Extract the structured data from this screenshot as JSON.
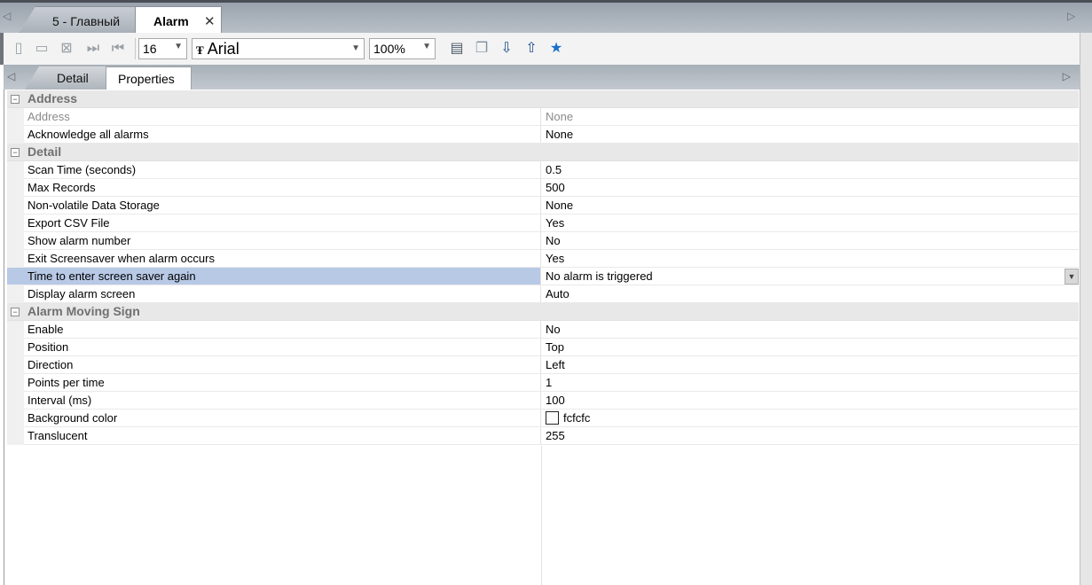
{
  "doc_tabs": [
    {
      "label": "5 - Главный",
      "active": false
    },
    {
      "label": "Alarm",
      "active": true
    }
  ],
  "toolbar": {
    "font_size": "16",
    "font_name": "Arial",
    "zoom": "100%",
    "icons": [
      "new-page-icon",
      "paste-icon",
      "delete-icon",
      "next-icon",
      "prev-icon",
      "export-icon",
      "layers-icon",
      "import-down-icon",
      "export-up-icon",
      "star-icon"
    ]
  },
  "sub_tabs": [
    {
      "label": "Detail",
      "active": false
    },
    {
      "label": "Properties",
      "active": true
    }
  ],
  "categories": {
    "address": "Address",
    "detail": "Detail",
    "moving_sign": "Alarm Moving Sign"
  },
  "props": {
    "address": [
      {
        "name": "Address",
        "value": "None",
        "disabled": true
      },
      {
        "name": "Acknowledge all alarms",
        "value": "None"
      }
    ],
    "detail": [
      {
        "name": "Scan Time (seconds)",
        "value": "0.5"
      },
      {
        "name": "Max Records",
        "value": "500"
      },
      {
        "name": "Non-volatile Data Storage",
        "value": "None"
      },
      {
        "name": "Export CSV File",
        "value": "Yes"
      },
      {
        "name": "Show alarm number",
        "value": "No"
      },
      {
        "name": "Exit Screensaver when alarm occurs",
        "value": "Yes"
      },
      {
        "name": "Time to enter screen saver again",
        "value": "No alarm is triggered",
        "selected": true
      },
      {
        "name": "Display alarm screen",
        "value": "Auto"
      }
    ],
    "moving_sign": [
      {
        "name": "Enable",
        "value": "No"
      },
      {
        "name": "Position",
        "value": "Top"
      },
      {
        "name": "Direction",
        "value": "Left"
      },
      {
        "name": "Points per time",
        "value": "1"
      },
      {
        "name": "Interval (ms)",
        "value": "100"
      },
      {
        "name": "Background color",
        "value": "fcfcfc",
        "swatch": "#fcfcfc"
      },
      {
        "name": "Translucent",
        "value": "255"
      }
    ]
  }
}
